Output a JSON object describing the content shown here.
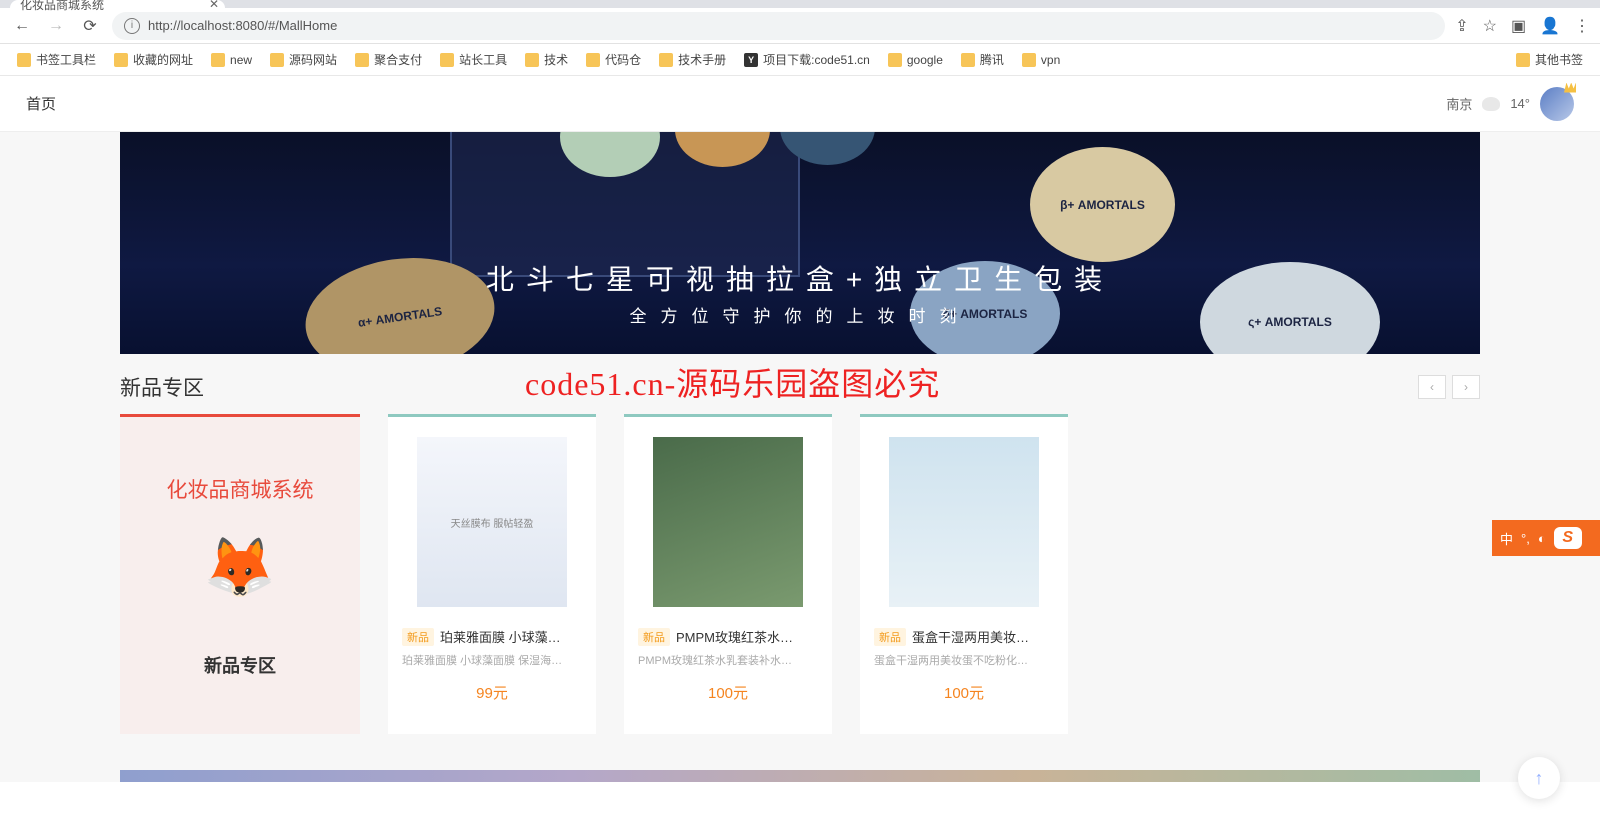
{
  "browser": {
    "tab_title": "化妆品商城系统",
    "url": "http://localhost:8080/#/MallHome",
    "bookmarks": [
      "书签工具栏",
      "收藏的网址",
      "new",
      "源码网站",
      "聚合支付",
      "站长工具",
      "技术",
      "代码仓",
      "技术手册"
    ],
    "bookmark_special": "项目下载:code51.cn",
    "bookmarks2": [
      "google",
      "腾讯",
      "vpn"
    ],
    "other_bookmarks": "其他书签"
  },
  "header": {
    "home": "首页",
    "city": "南京",
    "temp": "14°"
  },
  "hero": {
    "line1": "北斗七星可视抽拉盒+独立卫生包装",
    "line2": "全方位守护你的上妆时刻"
  },
  "section": {
    "title": "新品专区",
    "watermark": "code51.cn-源码乐园盗图必究"
  },
  "side_card": {
    "title": "化妆品商城系统",
    "subtitle": "新品专区"
  },
  "products": [
    {
      "badge": "新品",
      "name": "珀莱雅面膜 小球藻…",
      "desc": "珀莱雅面膜 小球藻面膜 保湿海…",
      "price": "99元"
    },
    {
      "badge": "新品",
      "name": "PMPM玫瑰红茶水…",
      "desc": "PMPM玫瑰红茶水乳套装补水…",
      "price": "100元"
    },
    {
      "badge": "新品",
      "name": "蛋盒干湿两用美妆…",
      "desc": "蛋盒干湿两用美妆蛋不吃粉化…",
      "price": "100元"
    }
  ],
  "ime": {
    "mode": "中",
    "sym1": "°,",
    "sym2": "◐"
  }
}
